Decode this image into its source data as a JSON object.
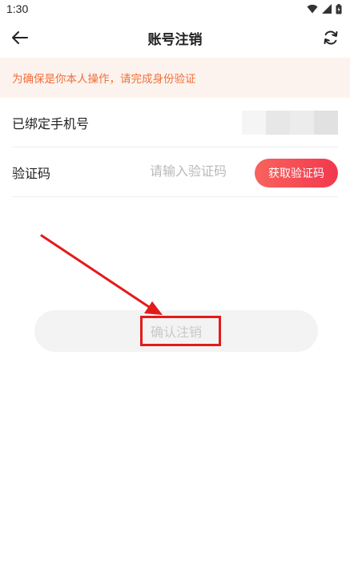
{
  "status_bar": {
    "time": "1:30"
  },
  "nav": {
    "title": "账号注销"
  },
  "notice": {
    "text": "为确保是你本人操作，请完成身份验证"
  },
  "phone_row": {
    "label": "已绑定手机号"
  },
  "code_row": {
    "label": "验证码",
    "placeholder": "请输入验证码",
    "button_label": "获取验证码"
  },
  "confirm": {
    "label": "确认注销"
  },
  "colors": {
    "accent": "#f2384e",
    "notice_bg": "#fdf3ee",
    "notice_text": "#f06f3a",
    "annotation": "#e31b1b"
  }
}
